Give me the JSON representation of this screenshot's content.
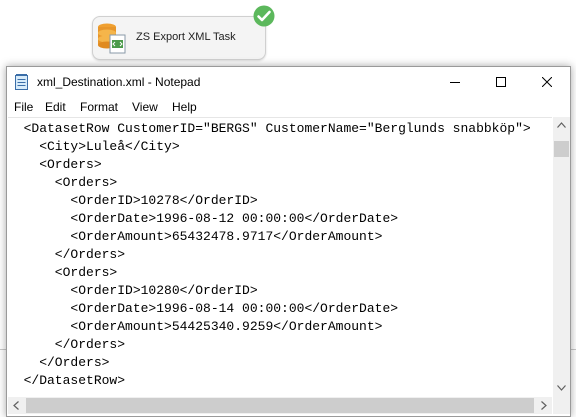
{
  "designer": {
    "task_label": "ZS Export XML Task",
    "task_icon": "database-xml-icon",
    "status_icon": "success-check-icon",
    "status_color": "#5cb85c"
  },
  "window": {
    "title": "xml_Destination.xml - Notepad",
    "app_icon": "notepad-icon",
    "controls": [
      "minimize",
      "maximize",
      "close"
    ]
  },
  "menu": [
    "File",
    "Edit",
    "Format",
    "View",
    "Help"
  ],
  "editor": {
    "lines": [
      "  <DatasetRow CustomerID=\"BERGS\" CustomerName=\"Berglunds snabbköp\">",
      "    <City>Luleå</City>",
      "    <Orders>",
      "      <Orders>",
      "        <OrderID>10278</OrderID>",
      "        <OrderDate>1996-08-12 00:00:00</OrderDate>",
      "        <OrderAmount>65432478.9717</OrderAmount>",
      "      </Orders>",
      "      <Orders>",
      "        <OrderID>10280</OrderID>",
      "        <OrderDate>1996-08-14 00:00:00</OrderDate>",
      "        <OrderAmount>54425340.9259</OrderAmount>",
      "      </Orders>",
      "    </Orders>",
      "  </DatasetRow>"
    ]
  }
}
